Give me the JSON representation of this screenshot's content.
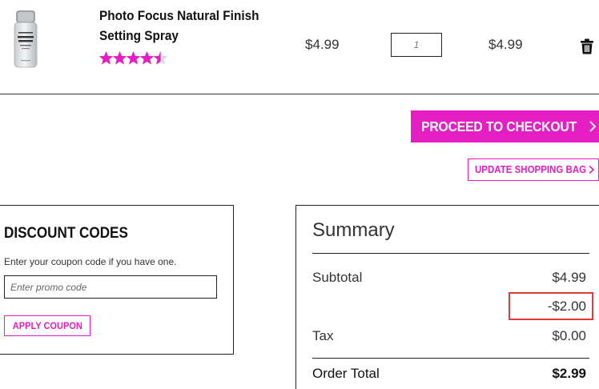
{
  "product": {
    "name": "Photo Focus Natural Finish Setting Spray",
    "rating": 4.5,
    "price": "$4.99",
    "quantity": "1",
    "line_total": "$4.99",
    "image_text": "NATURAL FINISH"
  },
  "actions": {
    "checkout_label": "PROCEED TO CHECKOUT",
    "update_label": "UPDATE SHOPPING BAG"
  },
  "discount": {
    "title": "DISCOUNT CODES",
    "help": "Enter your coupon code if you have one.",
    "placeholder": "Enter promo code",
    "apply_label": "APPLY COUPON"
  },
  "summary": {
    "title": "Summary",
    "subtotal_label": "Subtotal",
    "subtotal_value": "$4.99",
    "discount_value": "-$2.00",
    "tax_label": "Tax",
    "tax_value": "$0.00",
    "total_label": "Order Total",
    "total_value": "$2.99"
  },
  "colors": {
    "accent": "#e51ec4",
    "highlight": "#e53935",
    "text": "#111111"
  },
  "icons": {
    "star": "star-icon",
    "trash": "trash-icon",
    "chevron": "chevron-right-icon"
  }
}
